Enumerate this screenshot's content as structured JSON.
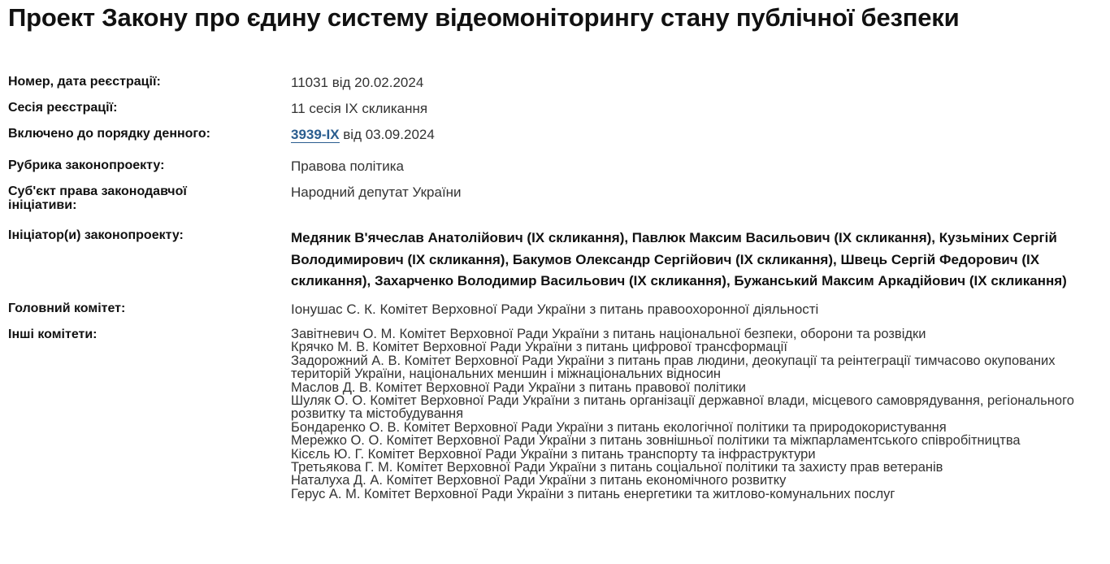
{
  "page": {
    "title": "Проект Закону про єдину систему відеомоніторингу стану публічної безпеки"
  },
  "registration": {
    "label": "Номер, дата реєстрації:",
    "value": "11031 від 20.02.2024"
  },
  "session": {
    "label": "Сесія реєстрації:",
    "value": "11 сесія IX скликання"
  },
  "agenda": {
    "label": "Включено до порядку денного:",
    "link": "3939-IX",
    "suffix": " від 03.09.2024"
  },
  "rubric": {
    "label": "Рубрика законопроекту:",
    "value": "Правова політика"
  },
  "subject": {
    "label": "Суб'єкт права законодавчої ініціативи:",
    "value": "Народний депутат України"
  },
  "initiators": {
    "label": "Ініціатор(и) законопроекту:",
    "value": "Медяник В'ячеслав Анатолійович (IX скликання), Павлюк Максим Васильович (IX скликання), Кузьміних Сергій Володимирович (IX скликання), Бакумов Олександр Сергійович (IX скликання), Швець Сергій Федорович (IX скликання), Захарченко Володимир Васильович (IX скликання), Бужанський Максим Аркадійович (IX скликання)"
  },
  "main_committee": {
    "label": "Головний комітет:",
    "value": "Іонушас С. К. Комітет Верховної Ради України з питань правоохоронної діяльності"
  },
  "other_committees": {
    "label": "Інші комітети:",
    "items": [
      "Завітневич О. М. Комітет Верховної Ради України з питань національної безпеки, оборони та розвідки",
      "Крячко М. В. Комітет Верховної Ради України з питань цифрової трансформації",
      "Задорожний А. В. Комітет Верховної Ради України з питань прав людини, деокупації та реінтеграції тимчасово окупованих територій України, національних меншин і міжнаціональних відносин",
      "Маслов Д. В. Комітет Верховної Ради України з питань правової політики",
      "Шуляк О. О. Комітет Верховної Ради України з питань організації державної влади, місцевого самоврядування, регіонального розвитку та містобудування",
      "Бондаренко О. В. Комітет Верховної Ради України з питань екологічної політики та природокористування",
      "Мережко О. О. Комітет Верховної Ради України з питань зовнішньої політики та міжпарламентського співробітництва",
      "Кісєль Ю. Г. Комітет Верховної Ради України з питань транспорту та інфраструктури",
      "Третьякова Г. М. Комітет Верховної Ради України з питань соціальної політики та захисту прав ветеранів",
      "Наталуха Д. А. Комітет Верховної Ради України з питань економічного розвитку",
      "Герус А. М. Комітет Верховної Ради України з питань енергетики та житлово-комунальних послуг"
    ]
  }
}
